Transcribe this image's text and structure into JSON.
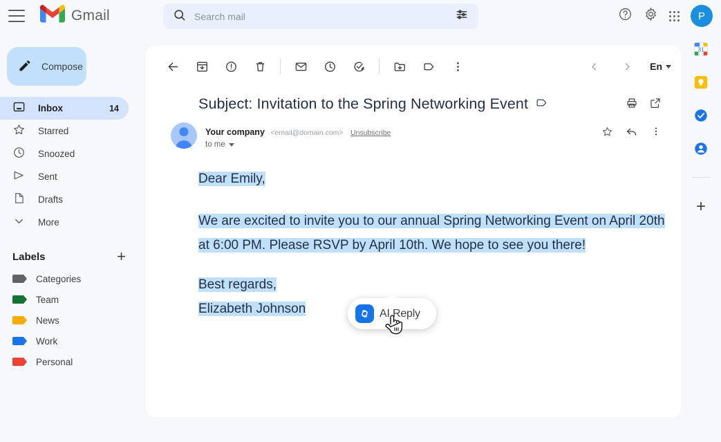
{
  "app": {
    "brand": "Gmail",
    "logo_icon": "gmail-m-logo",
    "menu_icon": "hamburger-menu-icon"
  },
  "search": {
    "placeholder": "Search mail",
    "value": "",
    "icon": "search-icon",
    "options_icon": "search-options-icon"
  },
  "top_right": {
    "help_icon": "help-icon",
    "settings_icon": "gear-icon",
    "apps_icon": "apps-grid-icon",
    "avatar_letter": "P",
    "avatar_color": "#1a8fe0"
  },
  "sidebar": {
    "compose": {
      "label": "Compose",
      "icon": "pencil-icon",
      "bg": "#c2e0fb"
    },
    "nav": [
      {
        "label": "Inbox",
        "icon": "inbox-icon",
        "count": "14",
        "active": true
      },
      {
        "label": "Starred",
        "icon": "star-icon",
        "count": "",
        "active": false
      },
      {
        "label": "Snoozed",
        "icon": "clock-icon",
        "count": "",
        "active": false
      },
      {
        "label": "Sent",
        "icon": "send-icon",
        "count": "",
        "active": false
      },
      {
        "label": "Drafts",
        "icon": "document-icon",
        "count": "",
        "active": false
      },
      {
        "label": "More",
        "icon": "chevron-down-icon",
        "count": "",
        "active": false
      }
    ],
    "labels_title": "Labels",
    "add_label_icon": "plus-icon",
    "labels": [
      {
        "name": "Categories",
        "color": "#5f6368"
      },
      {
        "name": "Team",
        "color": "#137333"
      },
      {
        "name": "News",
        "color": "#f9ab00"
      },
      {
        "name": "Work",
        "color": "#1a73e8"
      },
      {
        "name": "Personal",
        "color": "#ea4335"
      }
    ]
  },
  "toolbar": {
    "left_icons": [
      "back-arrow-icon",
      "archive-icon",
      "report-spam-icon",
      "delete-icon",
      "mark-unread-icon",
      "snooze-icon",
      "add-to-tasks-icon",
      "move-to-folder-icon",
      "labels-icon",
      "more-options-icon"
    ],
    "prev_icon": "previous-chevron-icon",
    "next_icon": "next-chevron-icon",
    "language": "En",
    "language_caret_icon": "chevron-down-icon"
  },
  "email": {
    "subject": "Subject: Invitation to the Spring Networking Event",
    "subject_label_icon": "label-tag-icon",
    "print_icon": "print-icon",
    "open_new_icon": "open-in-new-icon",
    "sender_name": "Your company",
    "sender_email": "<email@domain.com>",
    "unsubscribe": "Unsubscribe",
    "recipient": "to me",
    "recipient_caret_icon": "chevron-down-icon",
    "star_icon": "star-icon",
    "reply_icon": "reply-icon",
    "more_icon": "more-options-icon",
    "body": {
      "greeting": "Dear Emily,",
      "paragraph": "We are excited to invite you to our annual Spring Networking Event on April 20th at 6:00 PM. Please RSVP by April 10th. We hope to see you there!",
      "closing": "Best regards,",
      "signature": "Elizabeth Johnson",
      "selection_color": "#bfe0f8"
    }
  },
  "ai_popup": {
    "label": "AI Reply",
    "icon": "aireply-spiral-logo",
    "icon_bg": "#1673e8",
    "cursor": "pointing-hand-cursor"
  },
  "right_rail": {
    "items": [
      {
        "icon": "google-calendar-icon",
        "day": "31"
      },
      {
        "icon": "google-keep-icon"
      },
      {
        "icon": "google-tasks-icon"
      },
      {
        "icon": "google-contacts-icon"
      }
    ],
    "add_icon": "plus-icon"
  }
}
